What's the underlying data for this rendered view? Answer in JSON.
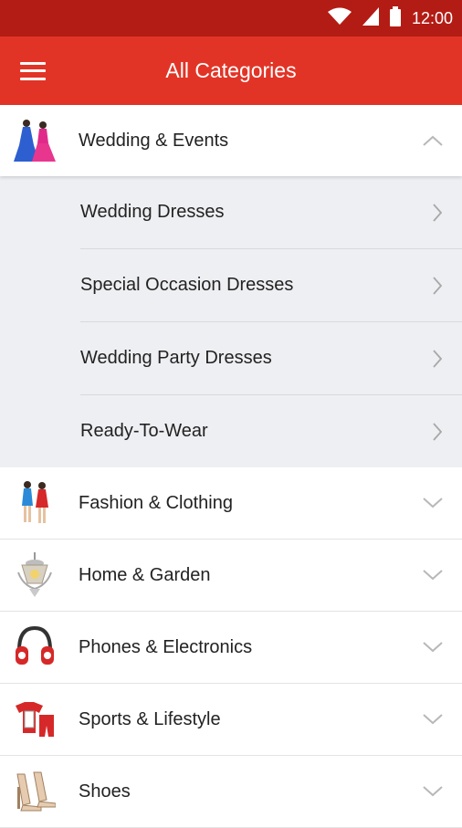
{
  "status_bar": {
    "time": "12:00",
    "icons": [
      "wifi-icon",
      "signal-icon",
      "battery-icon"
    ]
  },
  "app_bar": {
    "title": "All Categories",
    "menu_icon": "hamburger-icon"
  },
  "colors": {
    "primary": "#e23426",
    "status_bar": "#b31c14",
    "sub_bg": "#eeeff2"
  },
  "categories": [
    {
      "label": "Wedding & Events",
      "icon": "wedding-icon",
      "expanded": true,
      "subcategories": [
        {
          "label": "Wedding Dresses"
        },
        {
          "label": "Special Occasion Dresses"
        },
        {
          "label": "Wedding Party Dresses"
        },
        {
          "label": "Ready-To-Wear"
        }
      ]
    },
    {
      "label": "Fashion & Clothing",
      "icon": "fashion-icon",
      "expanded": false
    },
    {
      "label": "Home & Garden",
      "icon": "chandelier-icon",
      "expanded": false
    },
    {
      "label": "Phones & Electronics",
      "icon": "headphones-icon",
      "expanded": false
    },
    {
      "label": "Sports & Lifestyle",
      "icon": "sportswear-icon",
      "expanded": false
    },
    {
      "label": "Shoes",
      "icon": "shoes-icon",
      "expanded": false
    }
  ]
}
